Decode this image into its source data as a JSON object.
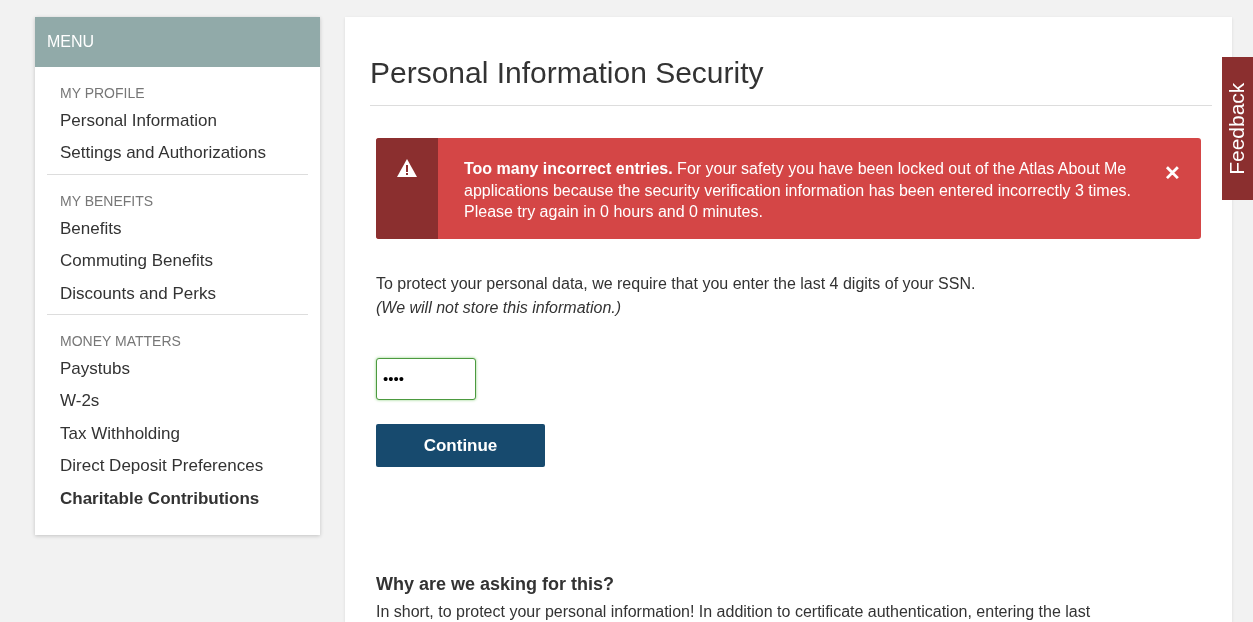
{
  "sidebar": {
    "title": "MENU",
    "sections": [
      {
        "heading": "MY PROFILE",
        "items": [
          {
            "label": "Personal Information",
            "selected": false
          },
          {
            "label": "Settings and Authorizations",
            "selected": false
          }
        ]
      },
      {
        "heading": "MY BENEFITS",
        "items": [
          {
            "label": "Benefits",
            "selected": false
          },
          {
            "label": "Commuting Benefits",
            "selected": false
          },
          {
            "label": "Discounts and Perks",
            "selected": false
          }
        ]
      },
      {
        "heading": "MONEY MATTERS",
        "items": [
          {
            "label": "Paystubs",
            "selected": false
          },
          {
            "label": "W-2s",
            "selected": false
          },
          {
            "label": "Tax Withholding",
            "selected": false
          },
          {
            "label": "Direct Deposit Preferences",
            "selected": false
          },
          {
            "label": "Charitable Contributions",
            "selected": true
          }
        ]
      }
    ]
  },
  "main": {
    "title": "Personal Information Security",
    "alert": {
      "kind": "danger",
      "message": "**Too many incorrect entries.** For your safety you have been locked out of the Atlas About Me applications because the security verification information has been entered incorrectly 3 times. Please try again in 0 hours and 0 minutes.",
      "close": "✕"
    },
    "instruction": "To protect your personal data, we require that you enter the last 4 digits of your SSN.",
    "note": "(We will not store this information.)",
    "ssn_field": {
      "value": "••••",
      "valid": true
    },
    "button": "Continue",
    "why_heading": "Why are we asking for this?",
    "why_text": "In short, to protect your personal information! In addition to certificate authentication, entering the last"
  },
  "feedback_tab": "Feedback"
}
